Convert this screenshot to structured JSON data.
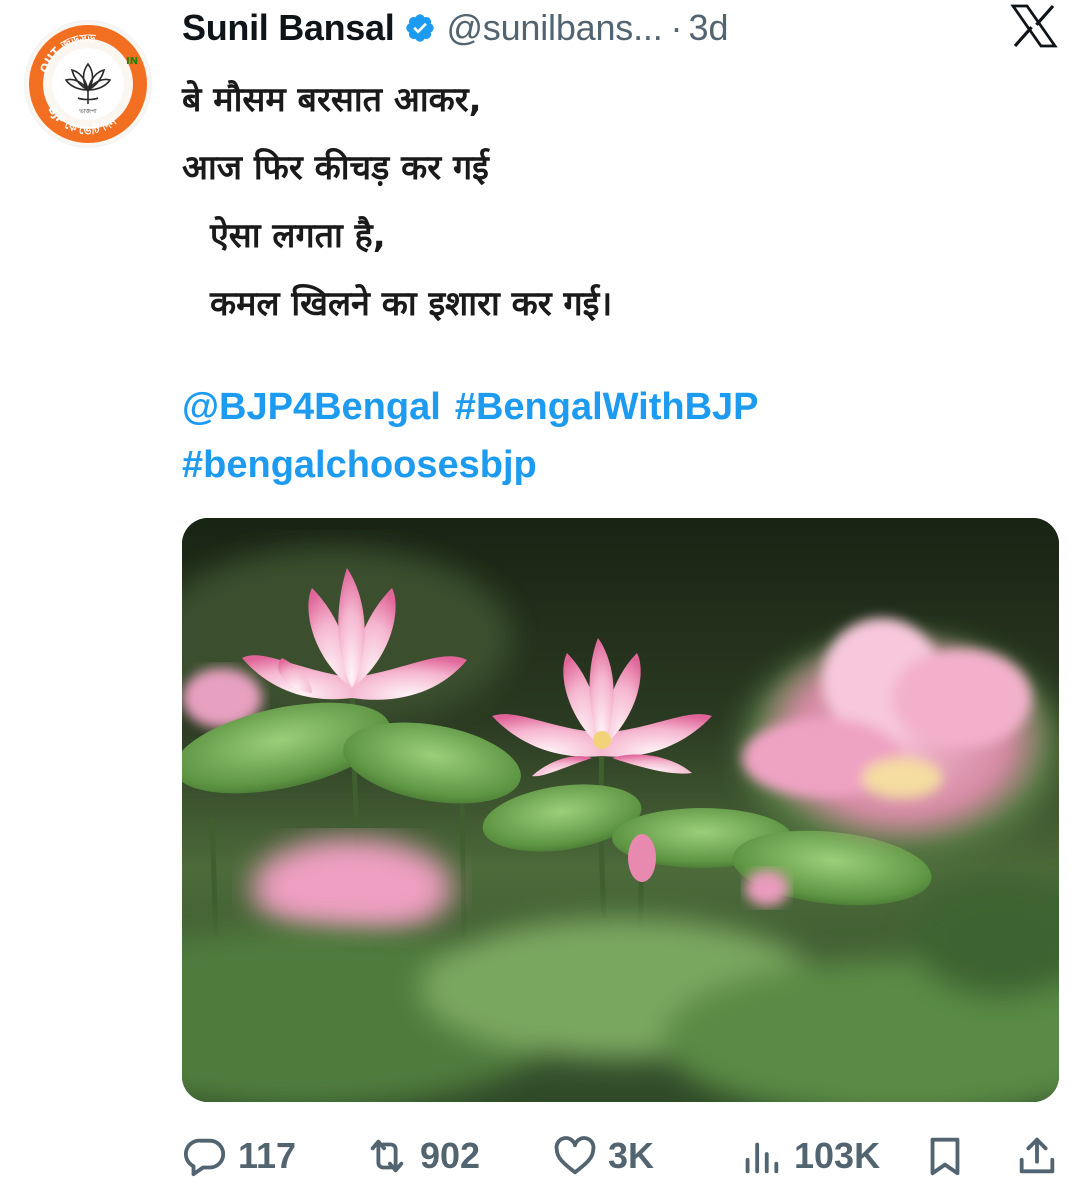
{
  "author": {
    "display_name": "Sunil Bansal",
    "handle": "@sunilbans...",
    "separator": "·",
    "time": "3d",
    "avatar_text": {
      "top": "OUT জড়সড়",
      "left": "জড়",
      "right": "IN",
      "bottom": "BJP কে ভোট দিন",
      "center": "ভাজপা"
    }
  },
  "tweet": {
    "lines": [
      "बे मौसम बरसात आकर,",
      "आज फिर कीचड़ कर गई",
      "ऐसा लगता है,",
      "कमल खिलने का इशारा कर गई।"
    ],
    "mention": "@BJP4Bengal",
    "hashtag1": "#BengalWithBJP",
    "hashtag2": "#bengalchoosesbjp"
  },
  "actions": {
    "replies": "117",
    "reposts": "902",
    "likes": "3K",
    "views": "103K"
  },
  "icons": {
    "verified": "verified-badge-icon",
    "platform": "x-logo-icon",
    "reply": "reply-icon",
    "repost": "repost-icon",
    "like": "heart-icon",
    "views": "views-bar-icon",
    "bookmark": "bookmark-icon",
    "share": "share-icon"
  },
  "colors": {
    "link": "#1d9bf0",
    "verified": "#1d9bf0",
    "muted": "#536471",
    "text": "#0f1419",
    "avatar_ring": "#f26f21"
  }
}
